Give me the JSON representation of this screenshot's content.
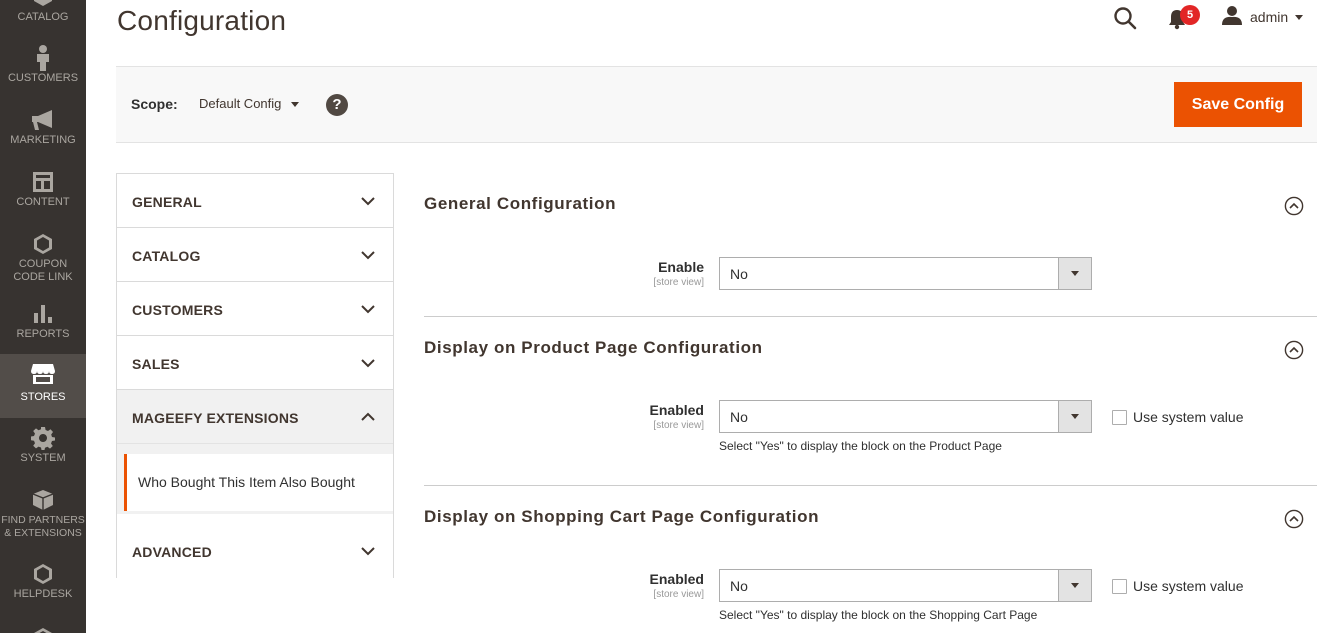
{
  "admin_menu": {
    "items": [
      {
        "label": "CATALOG",
        "icon": "catalog-icon"
      },
      {
        "label": "CUSTOMERS",
        "icon": "customers-icon"
      },
      {
        "label": "MARKETING",
        "icon": "megaphone-icon"
      },
      {
        "label": "CONTENT",
        "icon": "content-layout-icon"
      },
      {
        "label": "COUPON CODE LINK",
        "icon": "hexagon-icon"
      },
      {
        "label": "REPORTS",
        "icon": "bar-chart-icon"
      },
      {
        "label": "STORES",
        "icon": "storefront-icon",
        "active": true
      },
      {
        "label": "SYSTEM",
        "icon": "gear-icon"
      },
      {
        "label": "FIND PARTNERS & EXTENSIONS",
        "icon": "blocks-icon"
      },
      {
        "label": "HELPDESK",
        "icon": "hexagon-icon"
      }
    ]
  },
  "header": {
    "title": "Configuration",
    "notifications_count": "5",
    "user_name": "admin"
  },
  "scope": {
    "label": "Scope:",
    "value": "Default Config",
    "help": "?"
  },
  "actions": {
    "save_label": "Save Config"
  },
  "config_nav": {
    "groups": [
      {
        "label": "GENERAL"
      },
      {
        "label": "CATALOG"
      },
      {
        "label": "CUSTOMERS"
      },
      {
        "label": "SALES"
      },
      {
        "label": "MAGEEFY EXTENSIONS",
        "expanded": true,
        "items": [
          {
            "label": "Who Bought This Item Also Bought",
            "active": true
          }
        ]
      },
      {
        "label": "ADVANCED"
      }
    ]
  },
  "sections": [
    {
      "title": "General Configuration",
      "field": {
        "label": "Enable",
        "scope": "[store view]",
        "value": "No"
      }
    },
    {
      "title": "Display on Product Page Configuration",
      "field": {
        "label": "Enabled",
        "scope": "[store view]",
        "value": "No",
        "system_value_label": "Use system value",
        "note": "Select \"Yes\" to display the block on the Product Page"
      }
    },
    {
      "title": "Display on Shopping Cart Page Configuration",
      "field": {
        "label": "Enabled",
        "scope": "[store view]",
        "value": "No",
        "system_value_label": "Use system value",
        "note": "Select \"Yes\" to display the block on the Shopping Cart Page"
      }
    }
  ],
  "colors": {
    "menu_bg": "#373330",
    "menu_active_bg": "#524d49",
    "accent": "#eb5202",
    "badge": "#e22626"
  }
}
